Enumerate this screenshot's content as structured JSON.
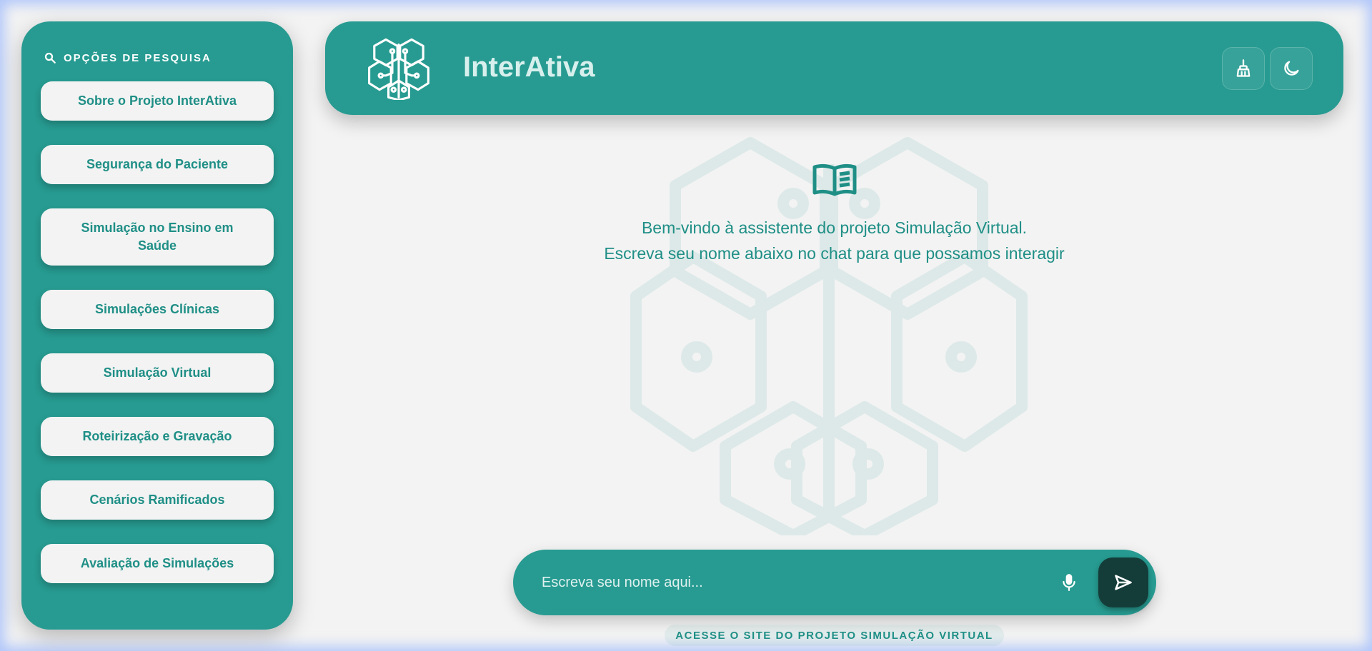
{
  "sidebar": {
    "header": "OPÇÕES DE PESQUISA",
    "items": [
      {
        "label": "Sobre o Projeto InterAtiva"
      },
      {
        "label": "Segurança do Paciente"
      },
      {
        "label": "Simulação no Ensino em Saúde"
      },
      {
        "label": "Simulações Clínicas"
      },
      {
        "label": "Simulação Virtual"
      },
      {
        "label": "Roteirização e Gravação"
      },
      {
        "label": "Cenários Ramificados"
      },
      {
        "label": "Avaliação de Simulações"
      }
    ]
  },
  "header": {
    "title": "InterAtiva",
    "logo_icon": "brain-circuit-icon",
    "clear_icon": "broom-icon",
    "theme_icon": "moon-icon"
  },
  "welcome": {
    "icon": "book-icon",
    "line1": "Bem-vindo à assistente do projeto Simulação Virtual.",
    "line2": "Escreva seu nome abaixo no chat para que possamos interagir"
  },
  "chat": {
    "placeholder": "Escreva seu nome aqui...",
    "value": "",
    "mic_icon": "microphone-icon",
    "send_icon": "send-icon"
  },
  "footer": {
    "link_label": "ACESSE O SITE DO PROJETO SIMULAÇÃO VIRTUAL"
  },
  "colors": {
    "primary": "#279b91",
    "text_accent": "#1f8f86",
    "background": "#f3f3f3",
    "send_button": "#143d39"
  }
}
